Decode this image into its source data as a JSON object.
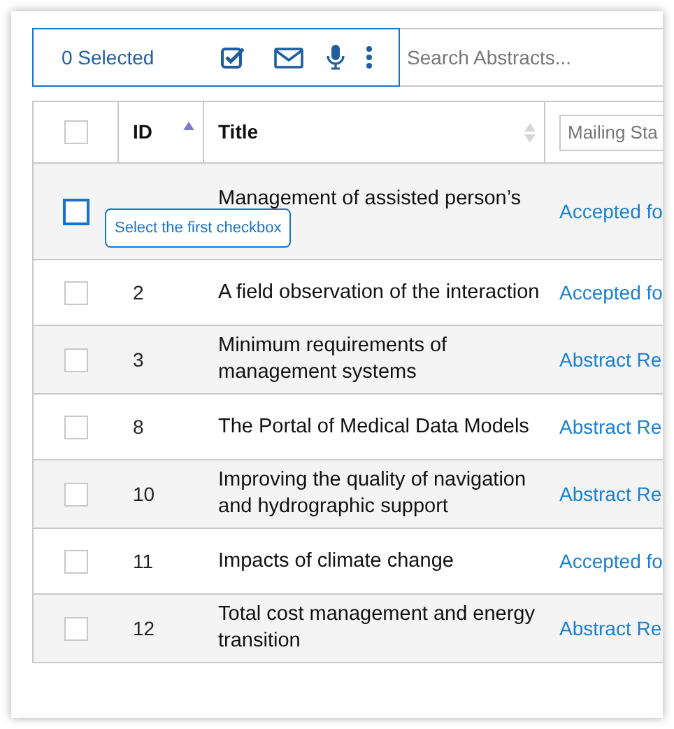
{
  "toolbar": {
    "selected_count": "0 Selected",
    "search": {
      "placeholder": "Search Abstracts..."
    }
  },
  "table": {
    "header": {
      "select_all": {
        "checked": false
      },
      "columns": [
        {
          "label": "ID",
          "sorted": true
        },
        {
          "label": "Title",
          "sorted": false
        }
      ],
      "filter": {
        "placeholder": "Mailing Sta"
      }
    },
    "rows": [
      {
        "id": "",
        "title": "Management of assisted person’s",
        "status": "Accepted fo",
        "checked": false,
        "focused": true
      },
      {
        "id": "2",
        "title": "A field observation of the interaction",
        "status": "Accepted fo",
        "checked": false,
        "focused": false
      },
      {
        "id": "3",
        "title": "Minimum requirements of management systems",
        "status": "Abstract Re",
        "checked": false,
        "focused": false
      },
      {
        "id": "8",
        "title": "The Portal of Medical Data Models",
        "status": "Abstract Re",
        "checked": false,
        "focused": false
      },
      {
        "id": "10",
        "title": "Improving the quality of navigation and hydrographic support",
        "status": "Abstract Re",
        "checked": false,
        "focused": false
      },
      {
        "id": "11",
        "title": "Impacts of climate change",
        "status": "Accepted fo",
        "checked": false,
        "focused": false
      },
      {
        "id": "12",
        "title": "Total cost management and energy transition",
        "status": "Abstract Re",
        "checked": false,
        "focused": false
      }
    ]
  },
  "tooltip": {
    "text": "Select the first checkbox"
  }
}
